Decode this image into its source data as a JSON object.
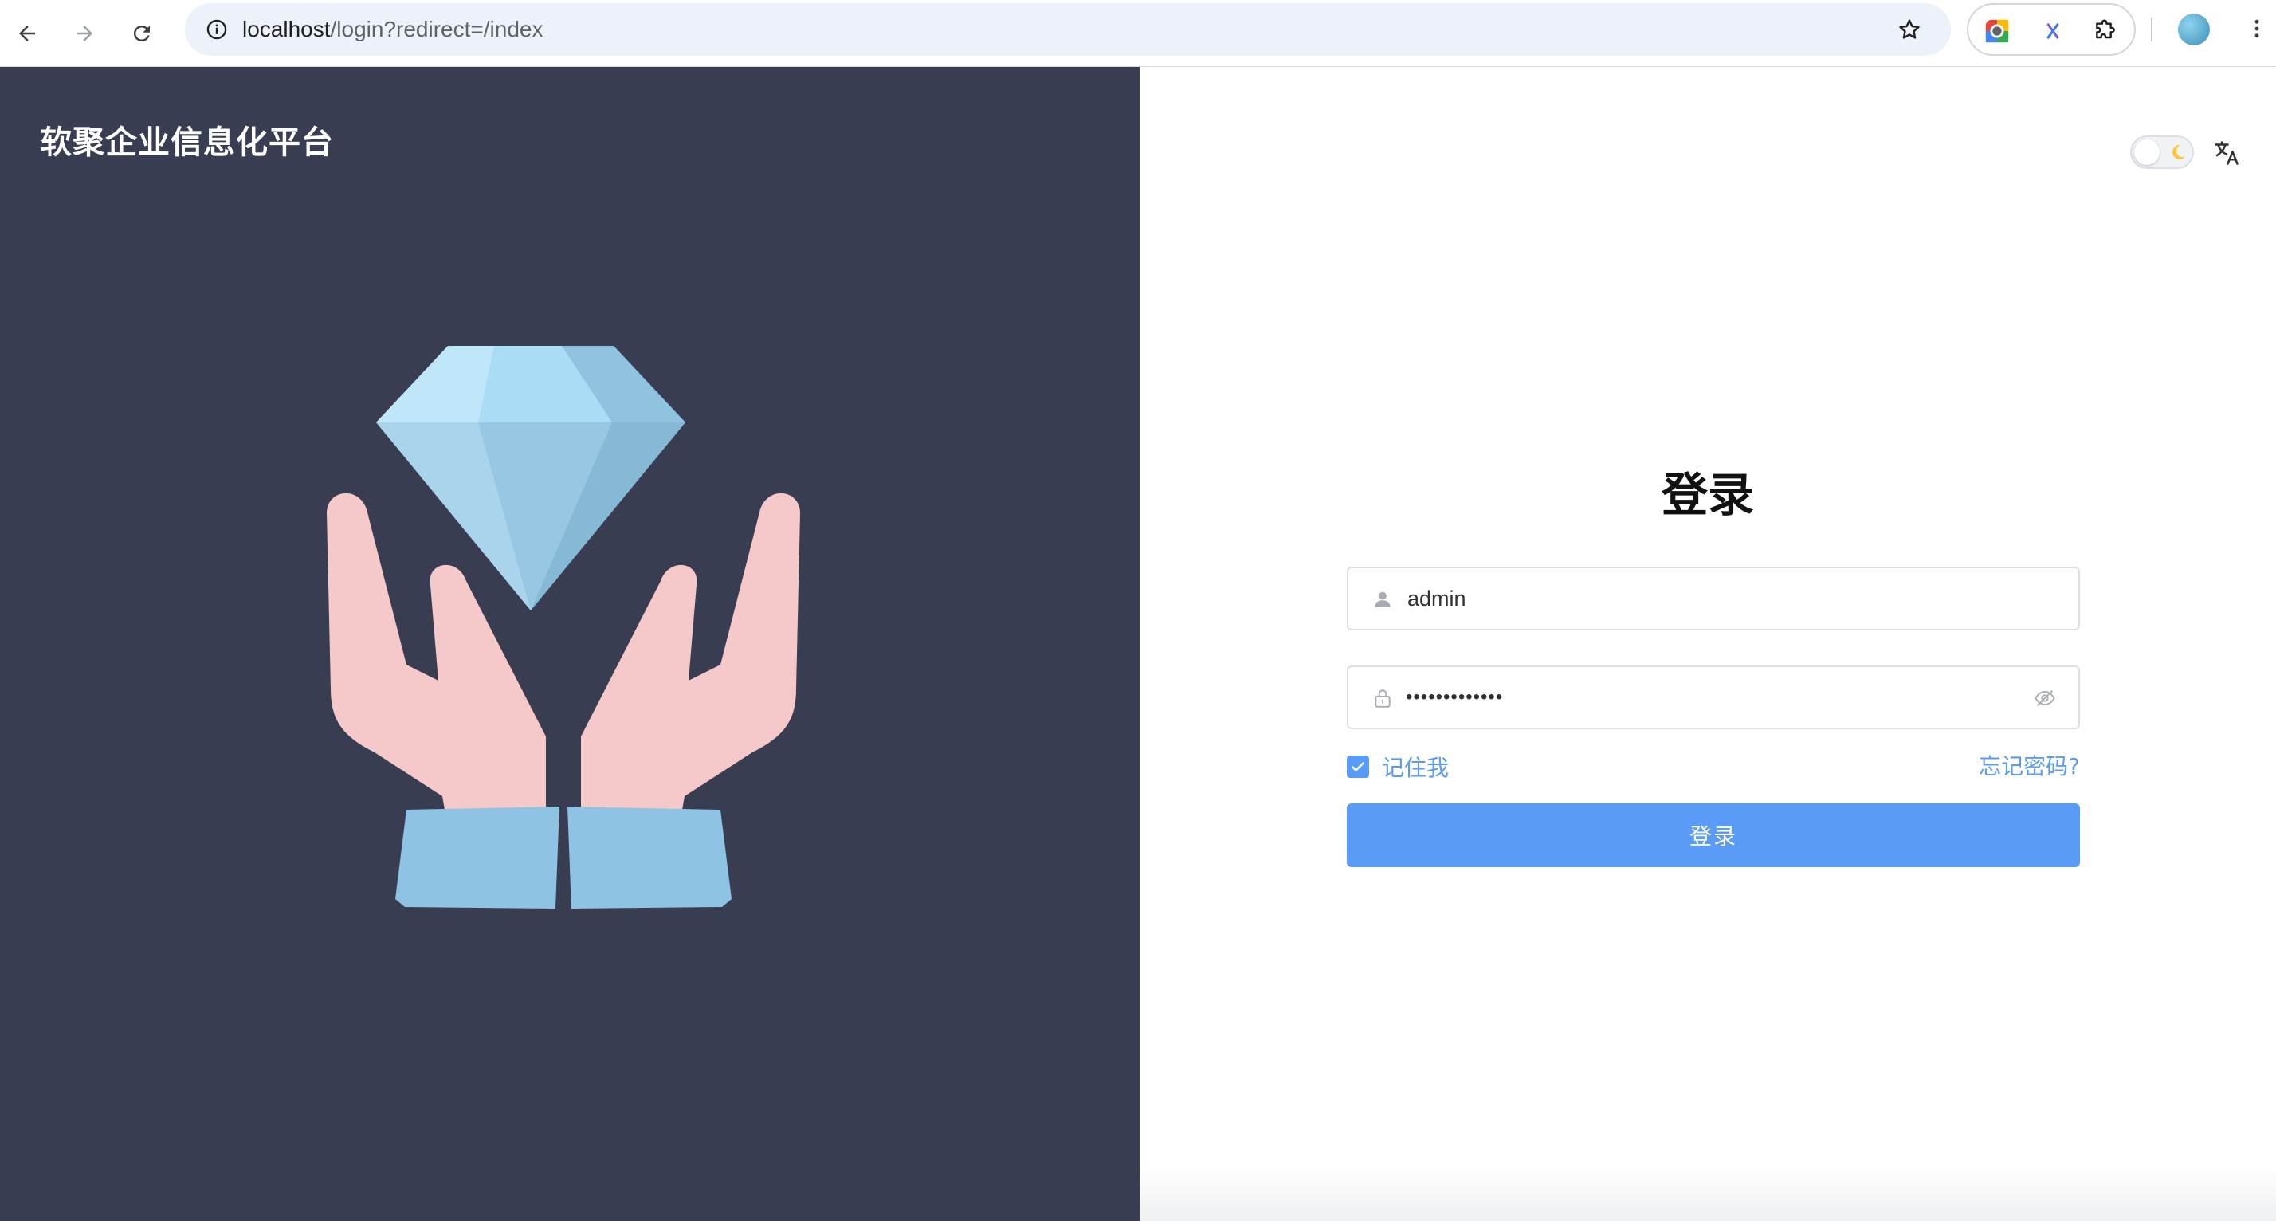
{
  "browser": {
    "url_host": "localhost",
    "url_path": "/login?redirect=/index",
    "icons": {
      "back": "back-arrow-icon",
      "forward": "forward-arrow-icon",
      "reload": "reload-icon",
      "site_info": "info-icon",
      "bookmark": "star-icon",
      "extensions": [
        "color-picker-extension-icon",
        "x-extension-icon",
        "puzzle-extensions-icon"
      ],
      "profile": "profile-avatar",
      "menu": "kebab-menu-icon"
    }
  },
  "left": {
    "brand": "软聚企业信息化平台",
    "background": "#383d52",
    "illustration": "hands-holding-diamond"
  },
  "right": {
    "theme_toggle_icon": "moon-icon",
    "language_icon": "translate-icon",
    "title": "登录",
    "username": {
      "value": "admin",
      "icon": "user-icon"
    },
    "password": {
      "masked_value": "•••••••••••••",
      "icon": "lock-icon",
      "toggle_icon": "eye-hidden-icon"
    },
    "remember_me": {
      "label": "记住我",
      "checked": true
    },
    "forgot_password": "忘记密码?",
    "submit": "登录",
    "accent_color": "#5b9bf8"
  }
}
